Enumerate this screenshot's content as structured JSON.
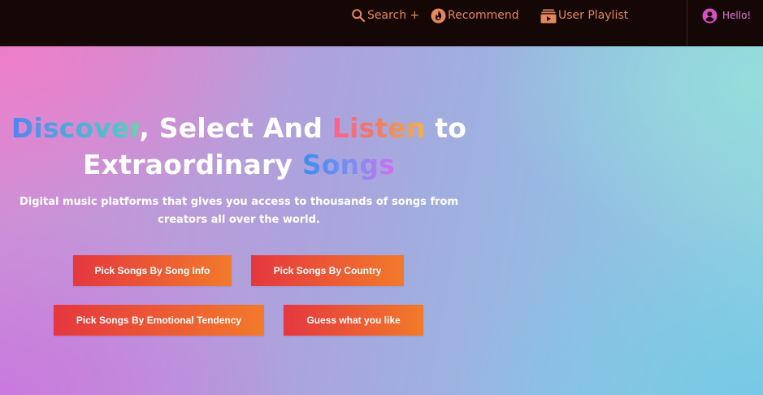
{
  "nav": {
    "search_label": "Search +",
    "recommend_label": "Recommend",
    "playlist_label": "User Playlist",
    "user_greeting": "Hello!",
    "icons": {
      "search": "search-icon",
      "recommend": "flame-icon",
      "playlist": "playlist-icon",
      "user": "user-avatar-icon"
    },
    "colors": {
      "background": "#160707",
      "link": "#e4875c",
      "user": "#e67ad9"
    }
  },
  "hero": {
    "headline": {
      "word_discover": "Discover",
      "text_select_and": ", Select And ",
      "word_listen": "Listen",
      "text_to": " to",
      "text_extraordinary": "Extraordinary ",
      "word_songs": "Songs"
    },
    "subtitle": "Digital music platforms that gives you access to thousands of songs from creators all over the world.",
    "buttons": {
      "song_info": "Pick Songs By Song Info",
      "country": "Pick Songs By Country",
      "emotional": "Pick Songs By Emotional Tendency",
      "guess": "Guess what you like"
    },
    "colors": {
      "button_start": "#e5373f",
      "button_end": "#f27a2a",
      "bg_left": "#d08fd6",
      "bg_right": "#8fd3e0"
    }
  }
}
